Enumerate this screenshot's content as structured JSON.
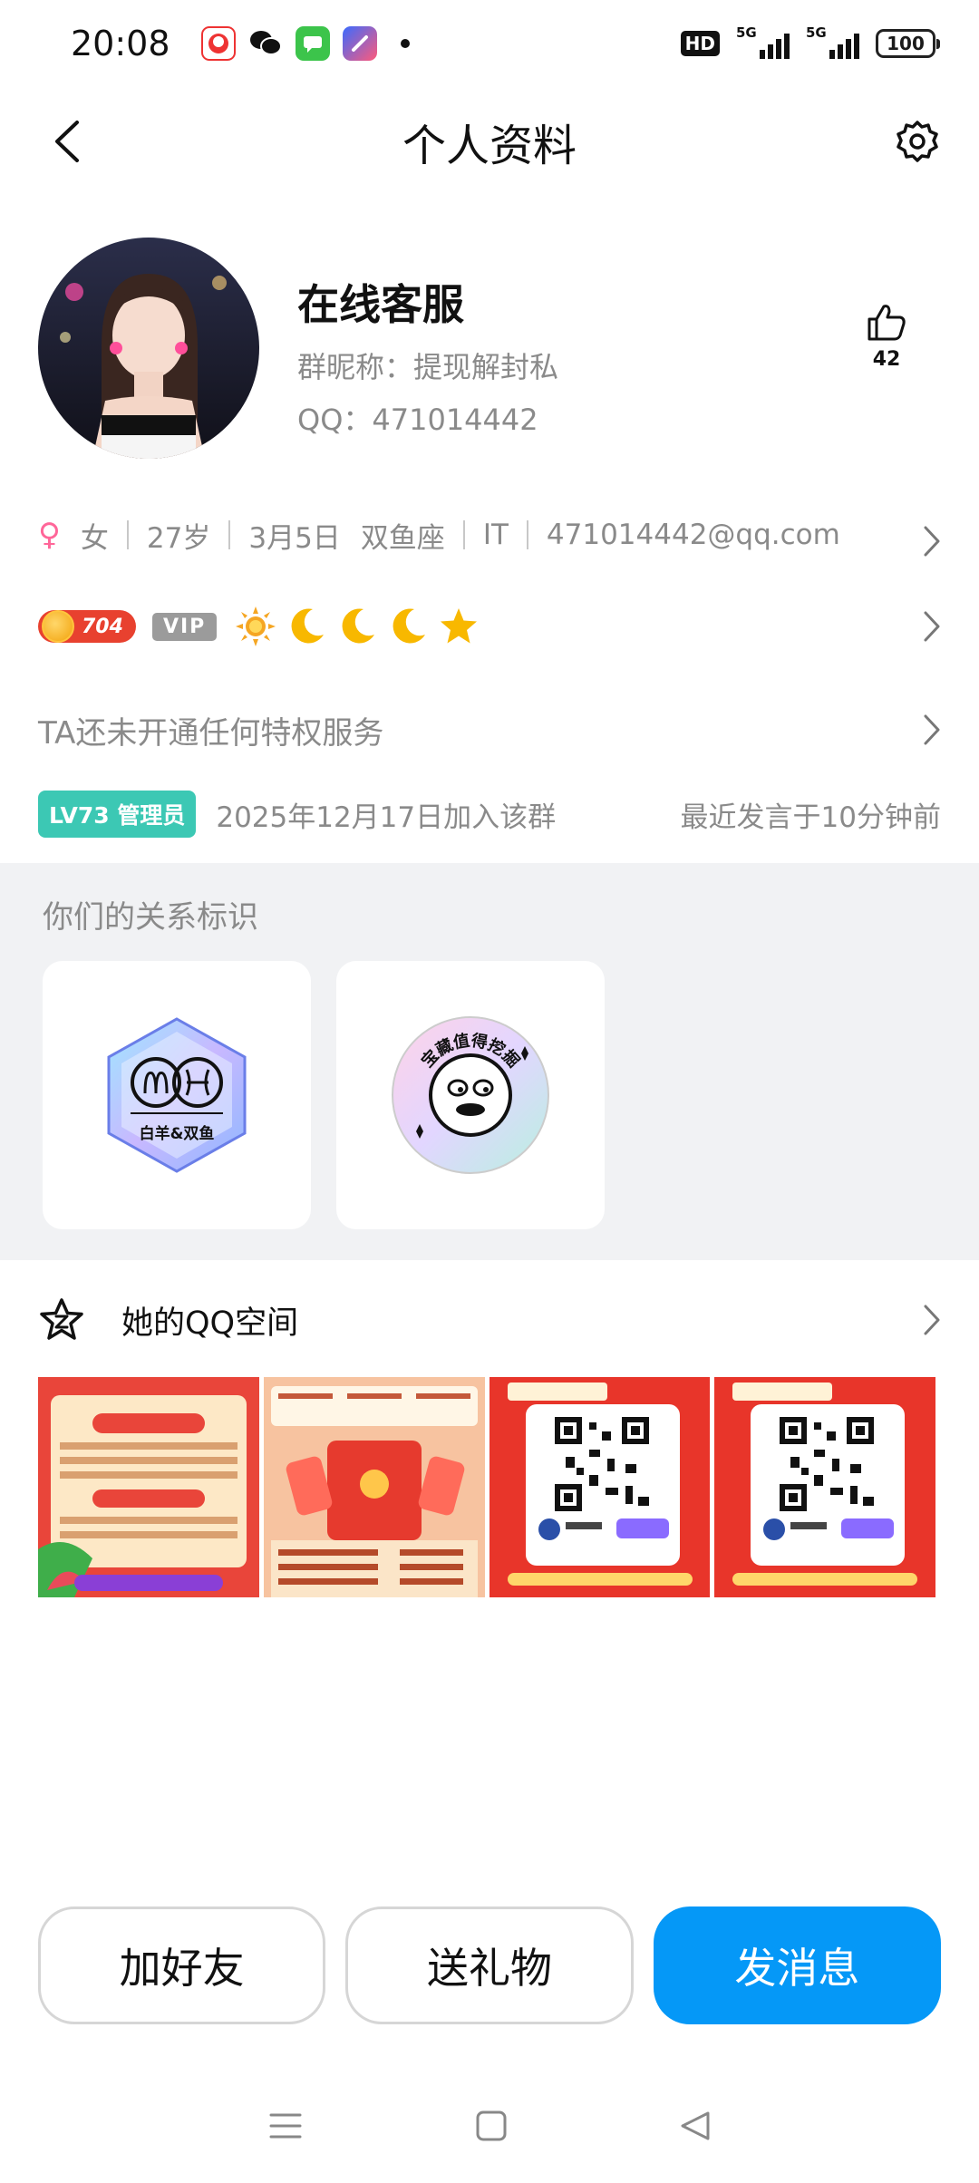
{
  "status_bar": {
    "time": "20:08",
    "hd_label": "HD",
    "network_1": "5G",
    "network_2": "5G",
    "battery": "100"
  },
  "header": {
    "title": "个人资料"
  },
  "profile": {
    "nickname": "在线客服",
    "group_nickname": "群昵称：提现解封私",
    "qq_number": "QQ：471014442",
    "like_count": "42"
  },
  "info": {
    "gender": "女",
    "age": "27岁",
    "birthday": "3月5日",
    "zodiac": "双鱼座",
    "industry": "IT",
    "email": "471014442@qq.com"
  },
  "level": {
    "number": "704",
    "vip_label": "VIP",
    "icons": [
      "sun-icon",
      "moon-icon",
      "moon-icon",
      "moon-icon",
      "star-icon"
    ]
  },
  "privilege": {
    "text": "TA还未开通任何特权服务"
  },
  "group": {
    "level_tag": "LV73 管理员",
    "join_text": "2025年12月17日加入该群",
    "recent_text": "最近发言于10分钟前"
  },
  "relationship": {
    "title": "你们的关系标识",
    "cards": [
      {
        "label": "白羊&双鱼"
      },
      {
        "label": "宝藏值得挖掘"
      }
    ]
  },
  "qzone": {
    "title": "她的QQ空间"
  },
  "actions": {
    "add_friend": "加好友",
    "send_gift": "送礼物",
    "send_message": "发消息"
  },
  "colors": {
    "primary": "#0598f7",
    "level_tag": "#3cc8b4",
    "level_pill": "#e8412f",
    "section_bg": "#f1f2f4"
  }
}
